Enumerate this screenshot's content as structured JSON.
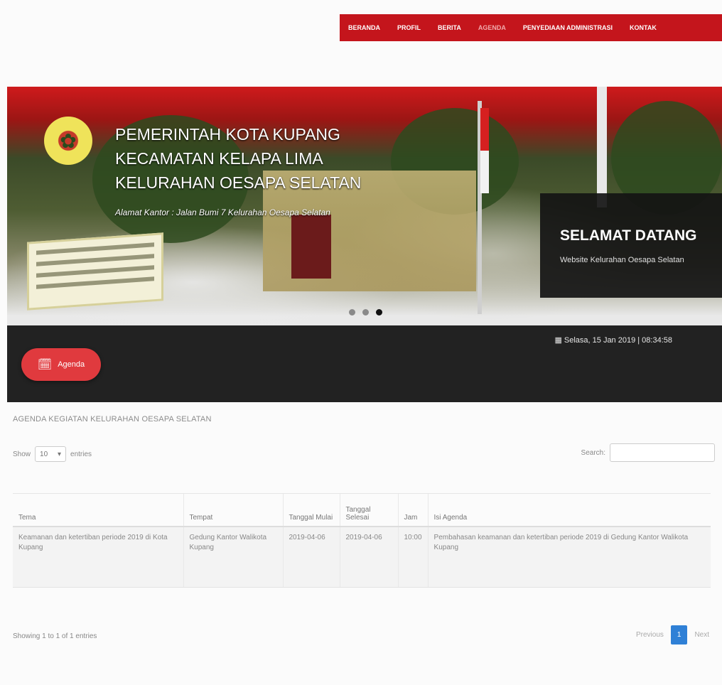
{
  "nav": {
    "items": [
      "BERANDA",
      "PROFIL",
      "BERITA",
      "AGENDA",
      "PENYEDIAAN ADMINISTRASI",
      "KONTAK"
    ],
    "active_index": 3
  },
  "banner": {
    "title_lines": [
      "PEMERINTAH KOTA KUPANG",
      "KECAMATAN KELAPA LIMA",
      "KELURAHAN OESAPA SELATAN"
    ],
    "address": "Alamat Kantor : Jalan Bumi 7 Kelurahan Oesapa Selatan",
    "welcome_title": "SELAMAT DATANG",
    "welcome_sub": "Website Kelurahan Oesapa Selatan",
    "slide_count": 3,
    "active_slide": 2
  },
  "band": {
    "datetime": "Selasa, 15 Jan 2019 | 08:34:58",
    "agenda_button": "Agenda"
  },
  "content": {
    "section_title": "AGENDA KEGIATAN KELURAHAN OESAPA SELATAN",
    "show_label": "Show",
    "entries_select": "10",
    "entries_label": "entries",
    "search_label": "Search:",
    "search_value": "",
    "columns": [
      "Tema",
      "Tempat",
      "Tanggal Mulai",
      "Tanggal Selesai",
      "Jam",
      "Isi Agenda"
    ],
    "rows": [
      {
        "tema": "Keamanan dan ketertiban periode 2019 di Kota Kupang",
        "tempat": "Gedung Kantor Walikota Kupang",
        "tanggal_mulai": "2019-04-06",
        "tanggal_selesai": "2019-04-06",
        "jam": "10:00",
        "isi": "Pembahasan keamanan dan ketertiban periode 2019 di Gedung Kantor Walikota Kupang"
      }
    ],
    "info": "Showing 1 to 1 of 1 entries",
    "pager": {
      "previous": "Previous",
      "current": "1",
      "next": "Next"
    }
  },
  "colors": {
    "nav_red": "#c4151c",
    "button_red": "#e03a3e",
    "band_dark": "#222222",
    "pager_blue": "#2f80d6"
  },
  "icons": {
    "calendar": "calendar-icon",
    "select_caret": "caret-down-icon"
  }
}
